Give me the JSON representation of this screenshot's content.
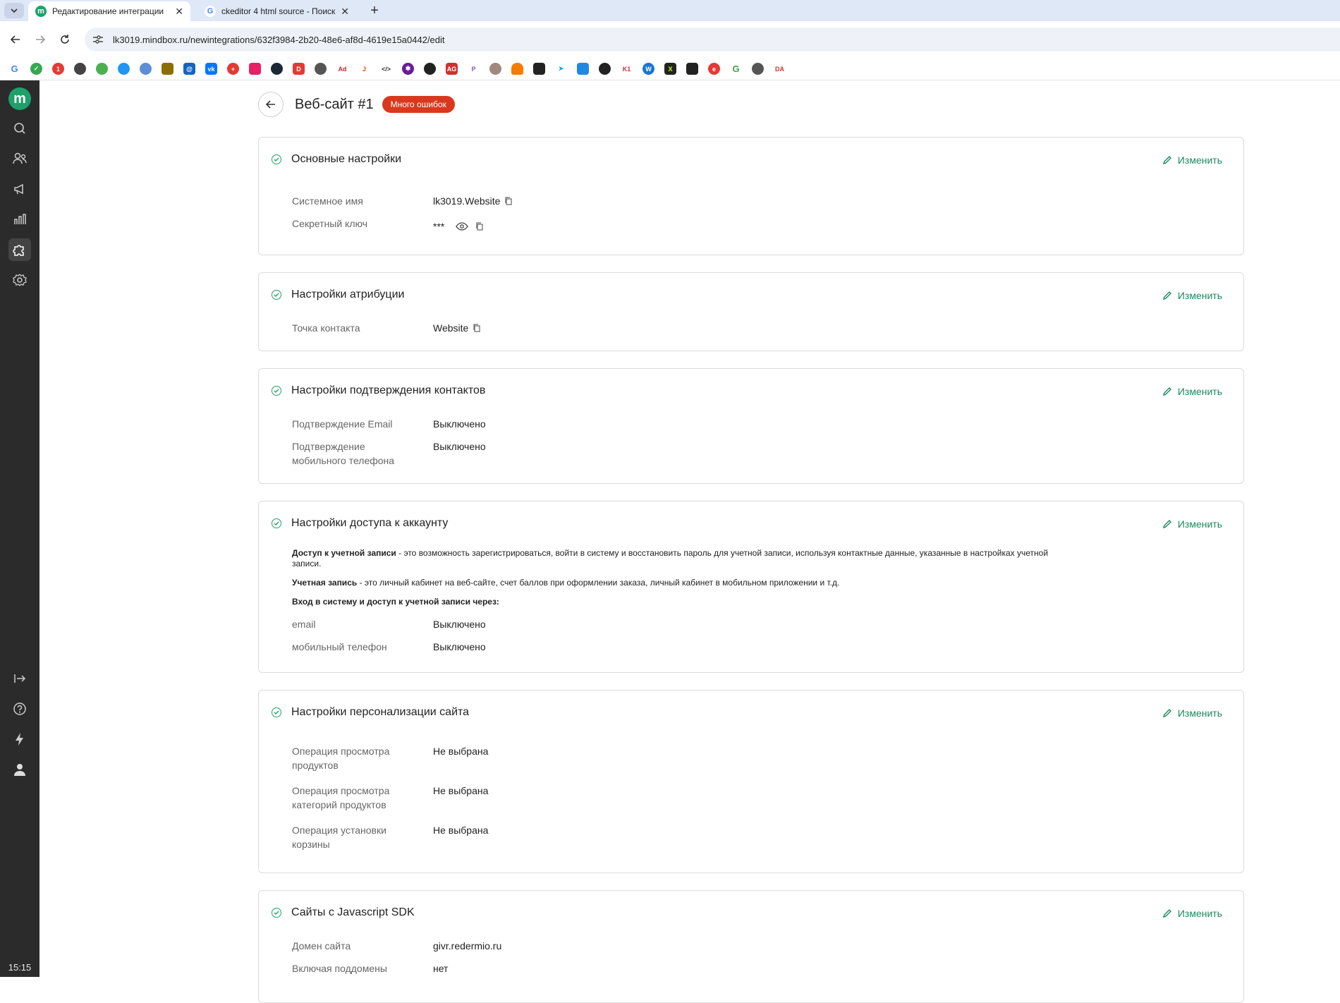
{
  "browser": {
    "tabs": [
      {
        "title": "Редактирование интеграции",
        "active": true
      },
      {
        "title": "ckeditor 4 html source - Поиск",
        "active": false
      }
    ],
    "url": "lk3019.mindbox.ru/newintegrations/632f3984-2b20-48e6-af8d-4619e15a0442/edit"
  },
  "sidebar": {
    "logo": "m",
    "clock": "15:15"
  },
  "header": {
    "title": "Веб-сайт #1",
    "badge": "Много ошибок"
  },
  "edit_label": "Изменить",
  "cards": {
    "basic": {
      "title": "Основные настройки",
      "rows": [
        {
          "label": "Системное имя",
          "value": "lk3019.Website"
        },
        {
          "label": "Секретный ключ",
          "value": "***"
        }
      ]
    },
    "attribution": {
      "title": "Настройки атрибуции",
      "rows": [
        {
          "label": "Точка контакта",
          "value": "Website"
        }
      ]
    },
    "confirm": {
      "title": "Настройки подтверждения контактов",
      "rows": [
        {
          "label": "Подтверждение Email",
          "value": "Выключено"
        },
        {
          "label": "Подтверждение мобильного телефона",
          "value": "Выключено"
        }
      ]
    },
    "access": {
      "title": "Настройки доступа к аккаунту",
      "p1_bold": "Доступ к учетной записи",
      "p1_text": " - это возможность зарегистрироваться, войти в систему и восстановить пароль для учетной записи, используя контактные данные, указанные в настройках учетной записи.",
      "p2_bold": "Учетная запись",
      "p2_text": " - это личный кабинет на веб-сайте, счет баллов при оформлении заказа, личный кабинет в мобильном приложении и т.д.",
      "p3_bold": "Вход в систему и доступ к учетной записи через:",
      "rows": [
        {
          "label": "email",
          "value": "Выключено"
        },
        {
          "label": "мобильный телефон",
          "value": "Выключено"
        }
      ]
    },
    "personalization": {
      "title": "Настройки персонализации сайта",
      "rows": [
        {
          "label": "Операция просмотра продуктов",
          "value": "Не выбрана"
        },
        {
          "label": "Операция просмотра категорий продуктов",
          "value": "Не выбрана"
        },
        {
          "label": "Операция установки корзины",
          "value": "Не выбрана"
        }
      ]
    },
    "sdk": {
      "title": "Сайты с Javascript SDK",
      "rows": [
        {
          "label": "Домен сайта",
          "value": "givr.redermio.ru"
        },
        {
          "label": "Включая поддомены",
          "value": "нет"
        }
      ]
    }
  }
}
